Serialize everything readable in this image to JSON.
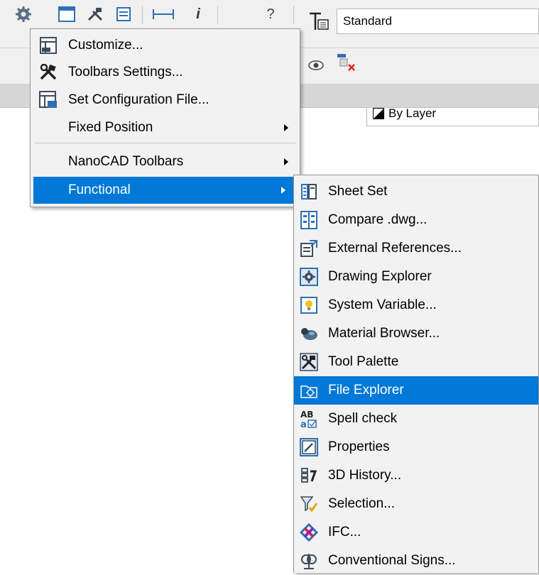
{
  "toolbar_top": {
    "icons": [
      "gear-icon",
      "cfg-window-icon",
      "tools-icon",
      "sheet-list-icon",
      "measure-icon",
      "info-icon",
      "help-icon"
    ],
    "help_text": "?",
    "text_style_icon": "text-style-icon",
    "text_style_value": "Standard"
  },
  "toolbar_second": {
    "icons": [
      "eye-icon",
      "layer-freeze-icon"
    ],
    "layer_value": "By Layer"
  },
  "main_menu": {
    "items": [
      {
        "label": "Customize...",
        "icon": "customize-icon",
        "has_submenu": false
      },
      {
        "label": "Toolbars Settings...",
        "icon": "tools-icon",
        "has_submenu": false
      },
      {
        "label": "Set Configuration File...",
        "icon": "config-file-icon",
        "has_submenu": false
      },
      {
        "label": "Fixed Position",
        "icon": "",
        "has_submenu": true
      },
      {
        "label": "NanoCAD Toolbars",
        "icon": "",
        "has_submenu": true
      },
      {
        "label": "Functional",
        "icon": "",
        "has_submenu": true,
        "highlighted": true
      }
    ]
  },
  "sub_menu": {
    "items": [
      {
        "label": "Sheet Set",
        "icon": "sheet-set-icon"
      },
      {
        "label": "Compare .dwg...",
        "icon": "compare-icon"
      },
      {
        "label": "External References...",
        "icon": "external-references-icon"
      },
      {
        "label": "Drawing Explorer",
        "icon": "drawing-explorer-icon"
      },
      {
        "label": "System Variable...",
        "icon": "system-variable-icon"
      },
      {
        "label": "Material Browser...",
        "icon": "material-browser-icon"
      },
      {
        "label": "Tool Palette",
        "icon": "tool-palette-icon"
      },
      {
        "label": "File Explorer",
        "icon": "file-explorer-icon",
        "highlighted": true
      },
      {
        "label": "Spell check",
        "icon": "spell-check-icon"
      },
      {
        "label": "Properties",
        "icon": "properties-icon"
      },
      {
        "label": "3D History...",
        "icon": "history-3d-icon"
      },
      {
        "label": "Selection...",
        "icon": "selection-icon"
      },
      {
        "label": "IFC...",
        "icon": "ifc-icon"
      },
      {
        "label": "Conventional Signs...",
        "icon": "conventional-signs-icon"
      }
    ]
  },
  "colors": {
    "highlight": "#0078d7",
    "menu_bg": "#f2f2f2",
    "toolbar_bg": "#f0f0f0"
  }
}
